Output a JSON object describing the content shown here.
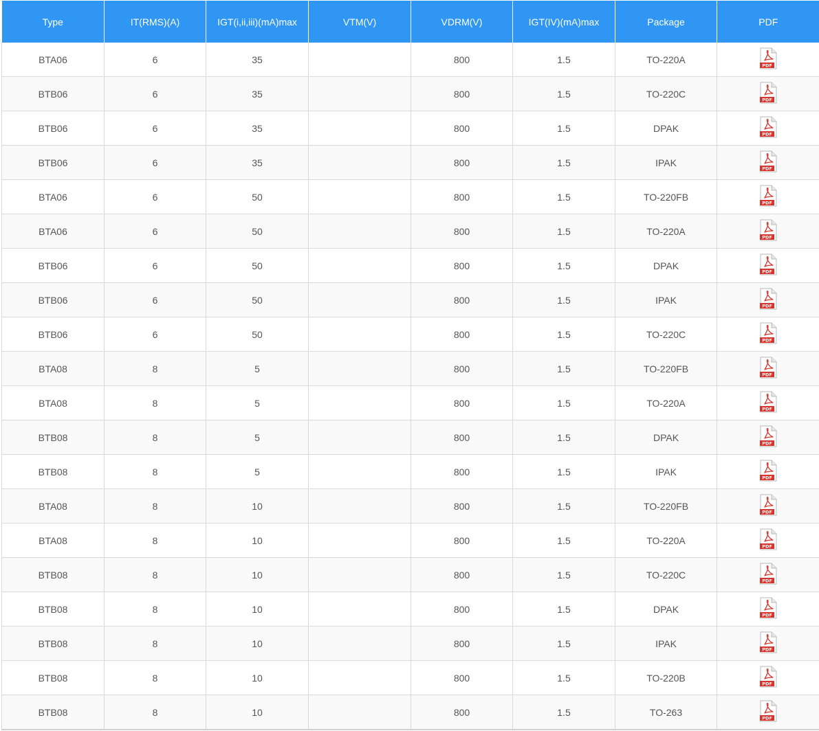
{
  "table": {
    "columns": [
      "Type",
      "IT(RMS)(A)",
      "IGT(i,ii,iii)(mA)max",
      "VTM(V)",
      "VDRM(V)",
      "IGT(IV)(mA)max",
      "Package",
      "PDF"
    ],
    "rows": [
      {
        "type": "BTA06",
        "it_rms": "6",
        "igt_123": "35",
        "vtm": "",
        "vdrm": "800",
        "igt_iv": "1.5",
        "package": "TO-220A"
      },
      {
        "type": "BTB06",
        "it_rms": "6",
        "igt_123": "35",
        "vtm": "",
        "vdrm": "800",
        "igt_iv": "1.5",
        "package": "TO-220C"
      },
      {
        "type": "BTB06",
        "it_rms": "6",
        "igt_123": "35",
        "vtm": "",
        "vdrm": "800",
        "igt_iv": "1.5",
        "package": "DPAK"
      },
      {
        "type": "BTB06",
        "it_rms": "6",
        "igt_123": "35",
        "vtm": "",
        "vdrm": "800",
        "igt_iv": "1.5",
        "package": "IPAK"
      },
      {
        "type": "BTA06",
        "it_rms": "6",
        "igt_123": "50",
        "vtm": "",
        "vdrm": "800",
        "igt_iv": "1.5",
        "package": "TO-220FB"
      },
      {
        "type": "BTA06",
        "it_rms": "6",
        "igt_123": "50",
        "vtm": "",
        "vdrm": "800",
        "igt_iv": "1.5",
        "package": "TO-220A"
      },
      {
        "type": "BTB06",
        "it_rms": "6",
        "igt_123": "50",
        "vtm": "",
        "vdrm": "800",
        "igt_iv": "1.5",
        "package": "DPAK"
      },
      {
        "type": "BTB06",
        "it_rms": "6",
        "igt_123": "50",
        "vtm": "",
        "vdrm": "800",
        "igt_iv": "1.5",
        "package": "IPAK"
      },
      {
        "type": "BTB06",
        "it_rms": "6",
        "igt_123": "50",
        "vtm": "",
        "vdrm": "800",
        "igt_iv": "1.5",
        "package": "TO-220C"
      },
      {
        "type": "BTA08",
        "it_rms": "8",
        "igt_123": "5",
        "vtm": "",
        "vdrm": "800",
        "igt_iv": "1.5",
        "package": "TO-220FB"
      },
      {
        "type": "BTA08",
        "it_rms": "8",
        "igt_123": "5",
        "vtm": "",
        "vdrm": "800",
        "igt_iv": "1.5",
        "package": "TO-220A"
      },
      {
        "type": "BTB08",
        "it_rms": "8",
        "igt_123": "5",
        "vtm": "",
        "vdrm": "800",
        "igt_iv": "1.5",
        "package": "DPAK"
      },
      {
        "type": "BTB08",
        "it_rms": "8",
        "igt_123": "5",
        "vtm": "",
        "vdrm": "800",
        "igt_iv": "1.5",
        "package": "IPAK"
      },
      {
        "type": "BTA08",
        "it_rms": "8",
        "igt_123": "10",
        "vtm": "",
        "vdrm": "800",
        "igt_iv": "1.5",
        "package": "TO-220FB"
      },
      {
        "type": "BTA08",
        "it_rms": "8",
        "igt_123": "10",
        "vtm": "",
        "vdrm": "800",
        "igt_iv": "1.5",
        "package": "TO-220A"
      },
      {
        "type": "BTB08",
        "it_rms": "8",
        "igt_123": "10",
        "vtm": "",
        "vdrm": "800",
        "igt_iv": "1.5",
        "package": "TO-220C"
      },
      {
        "type": "BTB08",
        "it_rms": "8",
        "igt_123": "10",
        "vtm": "",
        "vdrm": "800",
        "igt_iv": "1.5",
        "package": "DPAK"
      },
      {
        "type": "BTB08",
        "it_rms": "8",
        "igt_123": "10",
        "vtm": "",
        "vdrm": "800",
        "igt_iv": "1.5",
        "package": "IPAK"
      },
      {
        "type": "BTB08",
        "it_rms": "8",
        "igt_123": "10",
        "vtm": "",
        "vdrm": "800",
        "igt_iv": "1.5",
        "package": "TO-220B"
      },
      {
        "type": "BTB08",
        "it_rms": "8",
        "igt_123": "10",
        "vtm": "",
        "vdrm": "800",
        "igt_iv": "1.5",
        "package": "TO-263"
      }
    ]
  },
  "pdf_icon": {
    "name": "pdf-file-icon",
    "label": "PDF",
    "color": "#d9342b"
  },
  "colors": {
    "header_bg": "#2f96f3",
    "header_text": "#ffffff",
    "cell_text": "#555555",
    "row_alt": "#f9f9f9",
    "border": "#d9d9d9"
  }
}
